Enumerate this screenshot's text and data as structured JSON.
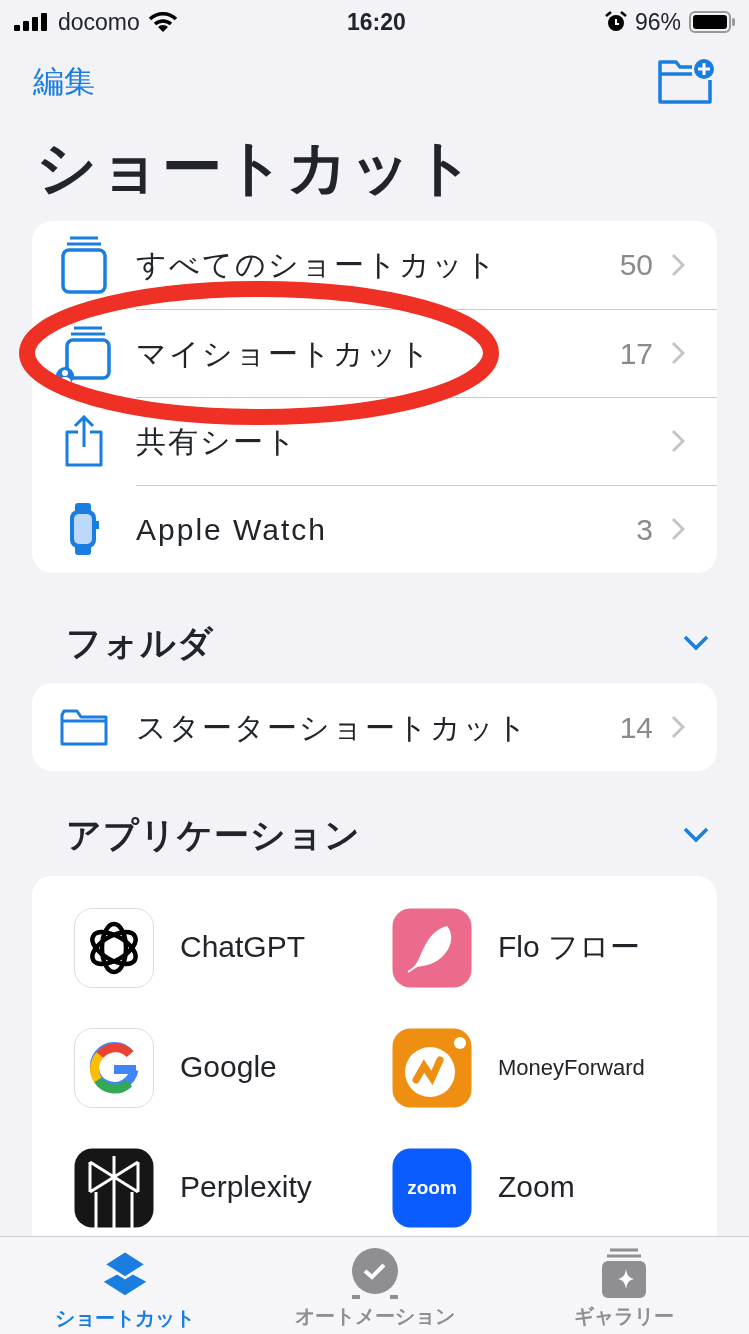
{
  "status_bar": {
    "carrier": "docomo",
    "time": "16:20",
    "battery": "96%"
  },
  "nav": {
    "edit": "編集"
  },
  "title": "ショートカット",
  "lists": [
    {
      "kind": "stack",
      "label": "すべてのショートカット",
      "count": "50"
    },
    {
      "kind": "stack-person",
      "label": "マイショートカット",
      "count": "17",
      "highlighted": true
    },
    {
      "kind": "share",
      "label": "共有シート"
    },
    {
      "kind": "watch",
      "label": "Apple Watch",
      "count": "3"
    }
  ],
  "folders": {
    "title": "フォルダ",
    "expanded": true,
    "items": [
      {
        "kind": "folder",
        "label": "スターターショートカット",
        "count": "14"
      }
    ]
  },
  "apps": {
    "title": "アプリケーション",
    "expanded": true,
    "items": [
      {
        "kind": "chatgpt",
        "label": "ChatGPT"
      },
      {
        "kind": "flo",
        "label": "Flo フロー"
      },
      {
        "kind": "google",
        "label": "Google"
      },
      {
        "kind": "moneyforward",
        "label": "MoneyForward"
      },
      {
        "kind": "perplexity",
        "label": "Perplexity"
      },
      {
        "kind": "zoom",
        "label": "Zoom",
        "icon_text": "zoom"
      }
    ]
  },
  "tabs": [
    {
      "kind": "shortcuts",
      "label": "ショートカット",
      "selected": true
    },
    {
      "kind": "automation",
      "label": "オートメーション",
      "selected": false
    },
    {
      "kind": "gallery",
      "label": "ギャラリー",
      "selected": false
    }
  ]
}
